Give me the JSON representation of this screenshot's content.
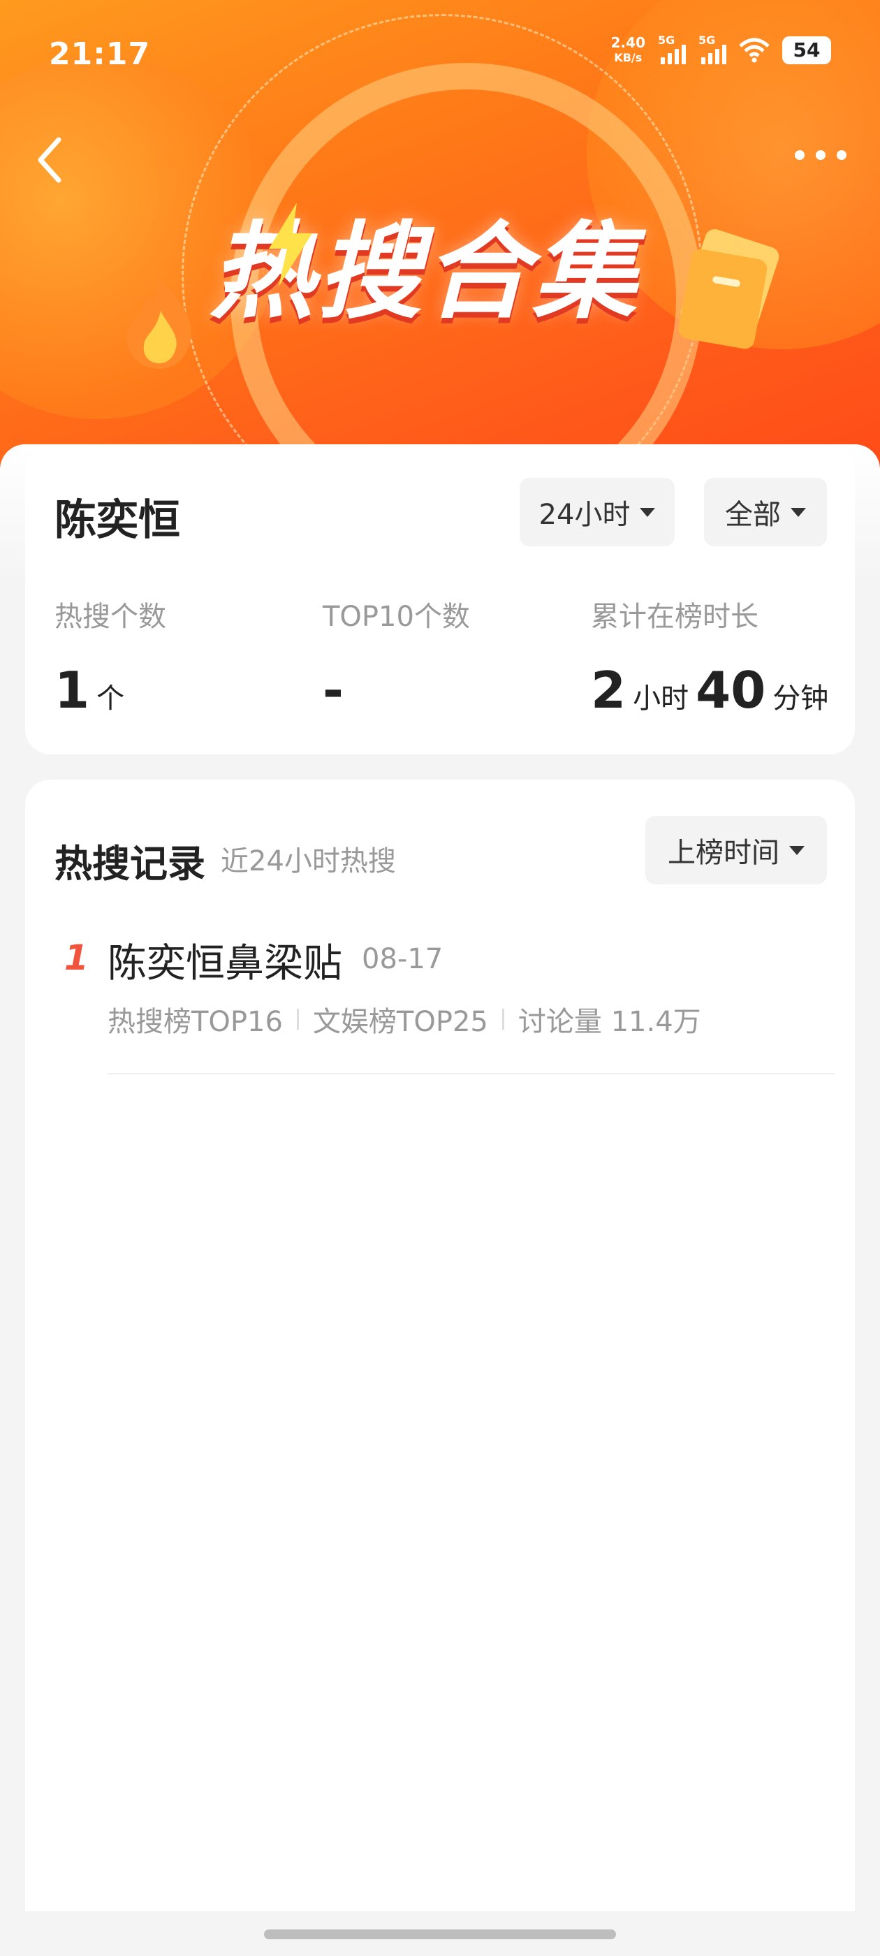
{
  "status_bar": {
    "time": "21:17",
    "speed": "2.40",
    "speed_unit": "KB/s",
    "signal1_label": "5G",
    "signal2_label": "5G",
    "battery": "54"
  },
  "header": {
    "title": "热搜合集"
  },
  "summary": {
    "name": "陈奕恒",
    "time_filter": "24小时",
    "scope_filter": "全部",
    "stats": [
      {
        "label": "热搜个数",
        "value": "1",
        "unit": "个"
      },
      {
        "label": "TOP10个数",
        "value": "-",
        "unit": ""
      },
      {
        "label": "累计在榜时长",
        "hours": "2",
        "hours_unit": "小时",
        "minutes": "40",
        "minutes_unit": "分钟"
      }
    ]
  },
  "records": {
    "title": "热搜记录",
    "subtitle": "近24小时热搜",
    "sort_label": "上榜时间",
    "items": [
      {
        "rank": "1",
        "title": "陈奕恒鼻梁贴",
        "date": "08-17",
        "meta": [
          "热搜榜TOP16",
          "文娱榜TOP25",
          "讨论量 11.4万"
        ]
      }
    ]
  },
  "colors": {
    "accent": "#ff6a1a",
    "rank": "#f0543c",
    "highlight": "#ffc98a"
  }
}
